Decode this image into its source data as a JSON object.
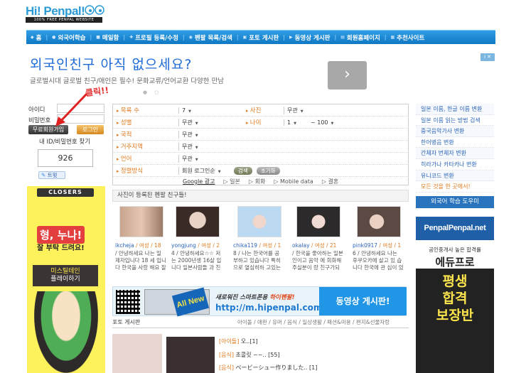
{
  "header": {
    "logo": "Hi! Penpal!",
    "logo_sub": "100% FREE PENPAL WEBSITE"
  },
  "nav": {
    "items": [
      "홈",
      "외국어학습",
      "메일함",
      "프로필 등록/수정",
      "펜팔 목록/검색",
      "포토 게시판",
      "동영상 게시판",
      "회원홈페이지",
      "추천사이트"
    ]
  },
  "ad": {
    "title": "외국인친구 아직 없으세요?",
    "text": "글로벌시대 글로벌 친구/애인은 필수! 문화교류/언어교환 다양한 만남",
    "next": "›",
    "dots": "● ○",
    "info": "i ✕"
  },
  "login": {
    "id_label": "아이디",
    "pw_label": "비밀번호",
    "join": "무료회원가입",
    "login": "로그인",
    "annotation": "클릭!!",
    "find": "내 ID/비밀번호 찾기",
    "counter": "926",
    "tweet": "트윗"
  },
  "search": {
    "rows": [
      {
        "label": "목록 수",
        "value": "7",
        "label2": "사진",
        "value2": "무관"
      },
      {
        "label": "성별",
        "value": "무관",
        "label2": "나이",
        "value2": "1",
        "value3": "~ 100"
      },
      {
        "label": "국적",
        "value": "무관"
      },
      {
        "label": "거주지역",
        "value": "무관"
      },
      {
        "label": "언어",
        "value": "무관"
      },
      {
        "label": "정렬방식",
        "value": "회원 로그인순",
        "search_btn": "검색",
        "reset_btn": "초기화"
      }
    ],
    "tabs": [
      "Google 광고",
      "▷ 일본",
      "▷ 회화",
      "▷ Mobile data",
      "▷ 결혼"
    ]
  },
  "right_links": [
    "일본 이름, 한글 이름 변환",
    "일본 이름 읽는 방법 검색",
    "중국음악가사 변환",
    "한어병음 변환",
    "간체자 번체자 변환",
    "히라가나 카타카나 변환",
    "유니코드 변환",
    "모든 것을 한 곳에서!"
  ],
  "helper": "외국어 학습 도우미",
  "penpal_banner": "PenpalPenpal.net",
  "photos": {
    "header": "사진이 등록된 펜팔 친구들!",
    "cards": [
      {
        "name": "ikcheja",
        "meta": "/ 여성 / 18",
        "desc": "/ 안녕하세요 나는 일 제자입니다 18 세 입니다 한국을 사랑 해요 잘 부탁.."
      },
      {
        "name": "yongjung",
        "meta": "/ 여성 / 2",
        "desc": "4 / 안녕하세요☆☆ 저는 2000년생 16살 입니다 일본사람들 과 친해지고싶습.."
      },
      {
        "name": "chika119",
        "meta": "/ 여성 / 1",
        "desc": "8 / 나는 한국어를 공부하고 있습니다 특히으로 열심히하 고있는데 사용하.."
      },
      {
        "name": "okalay",
        "meta": "/ 여성 / 21",
        "desc": "/ 한국을 좋아하는 일본인이고 음악 에 회화해주실분이 랑 친구가되고.."
      },
      {
        "name": "pink0917",
        "meta": "/ 여성 / 1",
        "desc": "6 / 안녕하세요 나는 후쿠오카에 살고 있 습니다 한국에 관 심이 있어서 한국어.."
      }
    ]
  },
  "mobile": {
    "line1": "새로워진 스마트폰용",
    "line1_brand": "하이펜팔!",
    "line2": "http://m.hipenpal.com",
    "allnew": "All New",
    "video": "동영상 게시판!"
  },
  "board": {
    "header": "포토 게시판",
    "cats": "아이돌 / 애완 / 유머 / 음식 / 일상생활 / 패션&미용 / 편지&선물자랑",
    "rows": [
      {
        "tag": "[아이돌]",
        "text": "오..[1]"
      },
      {
        "tag": "[음식]",
        "text": "초콜릿 ~~.. [55]"
      },
      {
        "tag": "[음식]",
        "text": "ベービーシュー作りました.. [1]"
      }
    ]
  },
  "left_ad": {
    "logo": "CLOSERS",
    "head": "형, 누나!",
    "sub": "잘 부탁 드려요!",
    "btn1": "미스틸테인",
    "btn2": "플레이하기"
  },
  "right_ad": {
    "top_small": "공인중개사 높은 합격률",
    "top_brand": "에듀프로",
    "big": "평생\n합격\n보장반"
  }
}
